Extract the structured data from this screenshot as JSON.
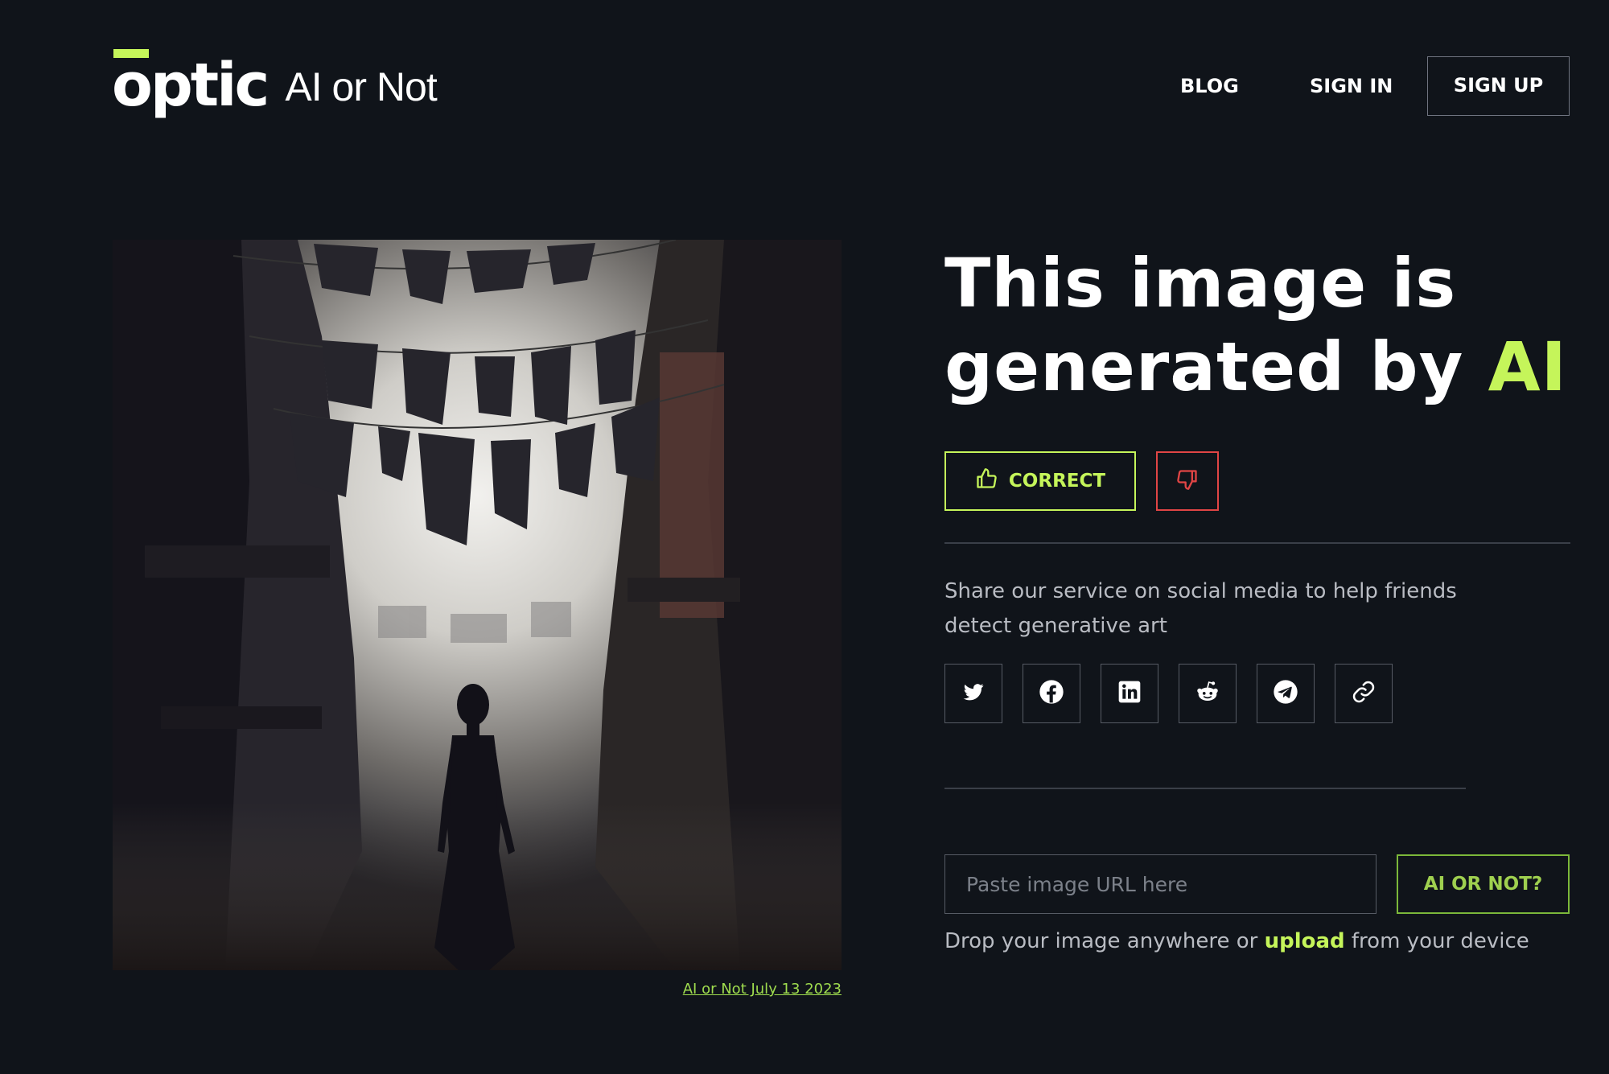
{
  "header": {
    "logo_word": "optic",
    "logo_sub": "AI or Not",
    "nav": {
      "blog": "BLOG",
      "sign_in": "SIGN IN",
      "sign_up": "SIGN UP"
    }
  },
  "result": {
    "headline_line1": "This image is",
    "headline_line2_prefix": "generated by ",
    "headline_highlight": "AI",
    "correct_label": "CORRECT",
    "accent_color": "#c5f55a",
    "incorrect_color": "#e04545"
  },
  "image": {
    "caption": "AI or Not July 13 2023"
  },
  "share": {
    "text": "Share our service on social media to help friends detect generative art",
    "icons": [
      "twitter-icon",
      "facebook-icon",
      "linkedin-icon",
      "reddit-icon",
      "telegram-icon",
      "link-icon"
    ]
  },
  "check": {
    "placeholder": "Paste image URL here",
    "button_label": "AI OR NOT?",
    "drop_prefix": "Drop your image anywhere or ",
    "drop_link": "upload",
    "drop_suffix": " from your device"
  }
}
